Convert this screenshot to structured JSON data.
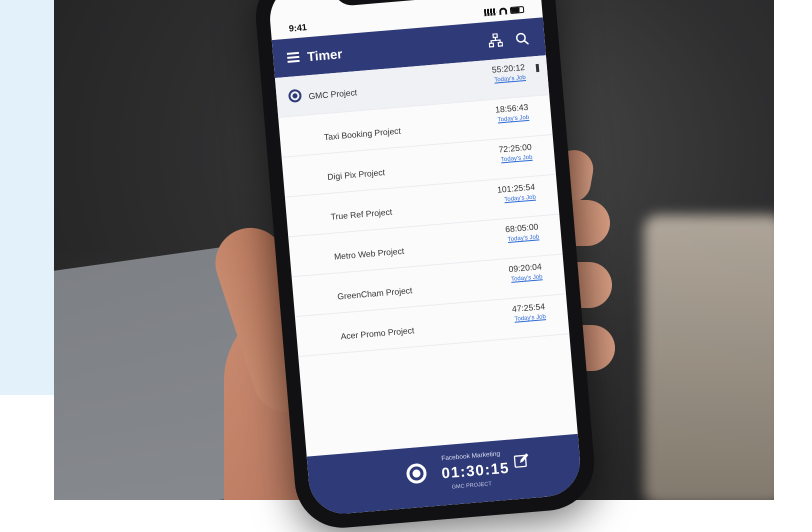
{
  "app": {
    "status_time": "9:41",
    "title": "Timer",
    "menu_icon": "menu-icon",
    "action_icons": [
      "hierarchy-icon",
      "search-icon"
    ]
  },
  "projects": [
    {
      "name": "GMC Project",
      "time": "55:20:12",
      "link": "Today's Job",
      "active": true
    },
    {
      "name": "Taxi Booking Project",
      "time": "18:56:43",
      "link": "Today's Job"
    },
    {
      "name": "Digi Pix Project",
      "time": "72:25:00",
      "link": "Today's Job"
    },
    {
      "name": "True Ref Project",
      "time": "101:25:54",
      "link": "Today's Job"
    },
    {
      "name": "Metro Web Project",
      "time": "68:05:00",
      "link": "Today's Job"
    },
    {
      "name": "GreenCham Project",
      "time": "09:20:04",
      "link": "Today's Job"
    },
    {
      "name": "Acer Promo Project",
      "time": "47:25:54",
      "link": "Today's Job"
    }
  ],
  "bottom_bar": {
    "task": "Facebook Marketing",
    "timer": "01:30:15",
    "sub": "GMC PROJECT"
  },
  "colors": {
    "primary": "#2f3a78",
    "link": "#2f6bd6",
    "background_left": "#e3f1fb"
  }
}
